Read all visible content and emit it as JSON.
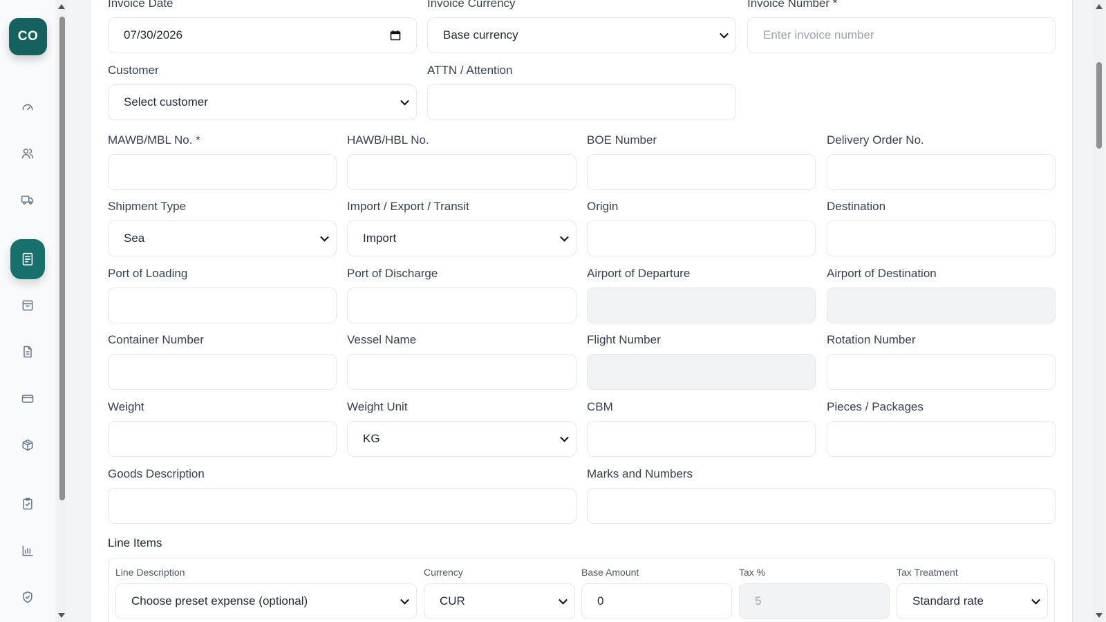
{
  "sidebar": {
    "logo_text": "CO",
    "items": [
      {
        "name": "dashboard-icon"
      },
      {
        "name": "users-icon"
      },
      {
        "name": "truck-icon"
      },
      {
        "name": "invoice-icon",
        "active": true
      },
      {
        "name": "inbox-icon"
      },
      {
        "name": "document-icon"
      },
      {
        "name": "credit-card-icon"
      },
      {
        "name": "package-icon"
      },
      {
        "name": "clipboard-check-icon"
      },
      {
        "name": "bar-chart-icon"
      },
      {
        "name": "shield-check-icon"
      }
    ]
  },
  "form": {
    "invoice_date": {
      "label": "Invoice Date",
      "value": "07/30/2026"
    },
    "invoice_currency": {
      "label": "Invoice Currency",
      "value": "Base currency"
    },
    "invoice_number": {
      "label": "Invoice Number *",
      "placeholder": "Enter invoice number"
    },
    "customer": {
      "label": "Customer",
      "value": "Select customer"
    },
    "attn": {
      "label": "ATTN / Attention",
      "value": ""
    },
    "mawb": {
      "label": "MAWB/MBL No. *",
      "value": ""
    },
    "hawb": {
      "label": "HAWB/HBL No.",
      "value": ""
    },
    "boe": {
      "label": "BOE Number",
      "value": ""
    },
    "delivery_order": {
      "label": "Delivery Order No.",
      "value": ""
    },
    "shipment_type": {
      "label": "Shipment Type",
      "value": "Sea"
    },
    "import_export": {
      "label": "Import / Export / Transit",
      "value": "Import"
    },
    "origin": {
      "label": "Origin",
      "value": ""
    },
    "destination": {
      "label": "Destination",
      "value": ""
    },
    "port_loading": {
      "label": "Port of Loading",
      "value": ""
    },
    "port_discharge": {
      "label": "Port of Discharge",
      "value": ""
    },
    "airport_departure": {
      "label": "Airport of Departure",
      "value": ""
    },
    "airport_destination": {
      "label": "Airport of Destination",
      "value": ""
    },
    "container_number": {
      "label": "Container Number",
      "value": ""
    },
    "vessel_name": {
      "label": "Vessel Name",
      "value": ""
    },
    "flight_number": {
      "label": "Flight Number",
      "value": ""
    },
    "rotation_number": {
      "label": "Rotation Number",
      "value": ""
    },
    "weight": {
      "label": "Weight",
      "value": ""
    },
    "weight_unit": {
      "label": "Weight Unit",
      "value": "KG"
    },
    "cbm": {
      "label": "CBM",
      "value": ""
    },
    "pieces": {
      "label": "Pieces / Packages",
      "value": ""
    },
    "goods_description": {
      "label": "Goods Description",
      "value": ""
    },
    "marks_numbers": {
      "label": "Marks and Numbers",
      "value": ""
    }
  },
  "line_items": {
    "title": "Line Items",
    "line_description": {
      "label": "Line Description",
      "value": "Choose preset expense (optional)"
    },
    "currency": {
      "label": "Currency",
      "value": "CUR"
    },
    "base_amount": {
      "label": "Base Amount",
      "value": "0"
    },
    "tax_percent": {
      "label": "Tax %",
      "value": "5"
    },
    "tax_treatment": {
      "label": "Tax Treatment",
      "value": "Standard rate"
    }
  }
}
